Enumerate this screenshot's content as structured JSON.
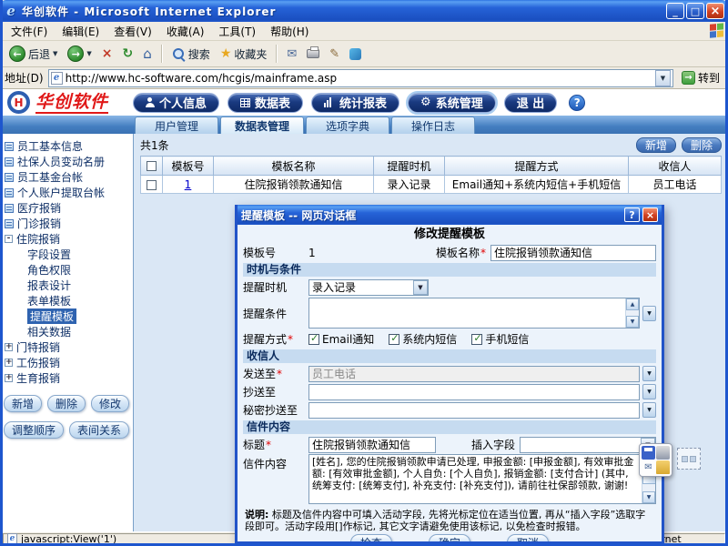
{
  "colors": {
    "titlebar_blue": "#2663D8",
    "close_button_red": "#D04022",
    "logo_red": "#E01818",
    "nav_button_navy": "#16336E",
    "tab_strip_blue": "#447EC0",
    "tree_selected_blue": "#2F63B0",
    "dialog_border_blue": "#2254C8",
    "section_bar_blue": "#C6DBF0",
    "link_blue": "#0000CC",
    "required_red": "#E00000"
  },
  "icons": {
    "ie_logo_glyph": "e",
    "minimize_glyph": "_",
    "maximize_glyph": "□",
    "close_glyph": "×",
    "back_glyph": "←",
    "forward_glyph": "→",
    "stop_glyph": "×",
    "refresh_glyph": "↻",
    "home_glyph": "⌂",
    "star_glyph": "★",
    "mail_glyph": "✉",
    "edit_glyph": "✎",
    "dropdown_glyph": "▼",
    "up_glyph": "▲",
    "down_glyph": "▼",
    "go_glyph": "→",
    "gear_glyph": "⚙",
    "help_glyph": "?",
    "check_glyph": "✓",
    "minus_glyph": "-",
    "plus_glyph": "+"
  },
  "browser": {
    "title": "华创软件 - Microsoft Internet Explorer",
    "menu_items": [
      "文件(F)",
      "编辑(E)",
      "查看(V)",
      "收藏(A)",
      "工具(T)",
      "帮助(H)"
    ],
    "toolbar": {
      "back_label": "后退",
      "search_label": "搜索",
      "favorites_label": "收藏夹"
    },
    "address": {
      "label": "地址(D)",
      "value": "http://www.hc-software.com/hcgis/mainframe.asp",
      "go_label": "转到"
    },
    "status": {
      "left": "javascript:View('1')",
      "zone": "Internet"
    }
  },
  "app": {
    "logo_text": "华创软件",
    "logo_monogram": "H",
    "nav_buttons": [
      {
        "label": "个人信息"
      },
      {
        "label": "数据表"
      },
      {
        "label": "统计报表"
      },
      {
        "label": "系统管理"
      },
      {
        "label": "退 出"
      }
    ],
    "tabs": [
      {
        "label": "用户管理"
      },
      {
        "label": "数据表管理"
      },
      {
        "label": "选项字典"
      },
      {
        "label": "操作日志"
      }
    ]
  },
  "sidebar": {
    "tree": [
      {
        "label": "员工基本信息"
      },
      {
        "label": "社保人员变动名册"
      },
      {
        "label": "员工基金台帐"
      },
      {
        "label": "个人账户提取台帐"
      },
      {
        "label": "医疗报销"
      },
      {
        "label": "门诊报销"
      },
      {
        "label": "住院报销"
      },
      {
        "label": "字段设置"
      },
      {
        "label": "角色权限"
      },
      {
        "label": "报表设计"
      },
      {
        "label": "表单模板"
      },
      {
        "label": "提醒模板"
      },
      {
        "label": "相关数据"
      },
      {
        "label": "门特报销"
      },
      {
        "label": "工伤报销"
      },
      {
        "label": "生育报销"
      }
    ],
    "buttons": [
      "新增",
      "删除",
      "修改",
      "调整顺序",
      "表间关系"
    ]
  },
  "content": {
    "record_count": "共1条",
    "buttons": [
      "新增",
      "删除"
    ],
    "table": {
      "headers": [
        "模板号",
        "模板名称",
        "提醒时机",
        "提醒方式",
        "收信人"
      ],
      "rows": [
        [
          "1",
          "住院报销领款通知信",
          "录入记录",
          "Email通知+系统内短信+手机短信",
          "员工电话"
        ]
      ]
    }
  },
  "dialog": {
    "title": "提醒模板 -- 网页对话框",
    "heading": "修改提醒模板",
    "required_mark": "*",
    "template_no_label": "模板号",
    "template_no_value": "1",
    "template_name_label": "模板名称",
    "template_name_value": "住院报销领款通知信",
    "section_timing": "时机与条件",
    "timing_label": "提醒时机",
    "timing_value": "录入记录",
    "condition_label": "提醒条件",
    "condition_value": "",
    "method_label": "提醒方式",
    "methods": [
      {
        "label": "Email通知",
        "checked": true
      },
      {
        "label": "系统内短信",
        "checked": true
      },
      {
        "label": "手机短信",
        "checked": true
      }
    ],
    "section_recipient": "收信人",
    "send_to_label": "发送至",
    "send_to_value": "员工电话",
    "cc_label": "抄送至",
    "cc_value": "",
    "bcc_label": "秘密抄送至",
    "bcc_value": "",
    "section_mail": "信件内容",
    "subject_label": "标题",
    "subject_value": "住院报销领款通知信",
    "insert_field_label": "插入字段",
    "insert_field_value": "",
    "body_label": "信件内容",
    "body_value": "[姓名], 您的住院报销领款申请已处理, 申报金额: [申报金额], 有效审批金额: [有效审批金额], 个人自负: [个人自负], 报销金额: [支付合计] (其中, 统筹支付: [统筹支付], 补充支付: [补充支付]), 请前往社保部领款, 谢谢!",
    "note_label": "说明:",
    "note_text": "标题及信件内容中可填入活动字段, 先将光标定位在适当位置, 再从“插入字段”选取字段即可。活动字段用[]作标记, 其它文字请避免使用该标记, 以免检查时报错。",
    "buttons": [
      "检查",
      "确定",
      "取消"
    ]
  }
}
